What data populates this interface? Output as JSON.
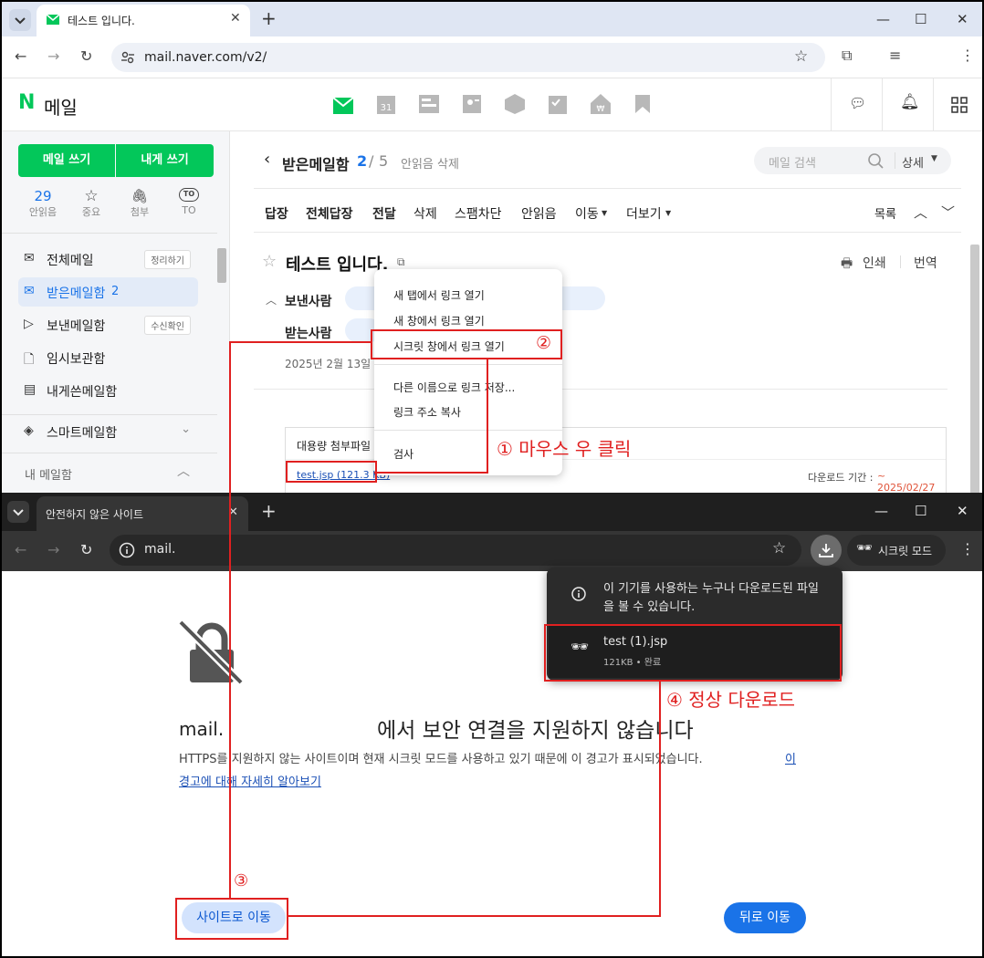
{
  "top_browser": {
    "tab_title": "테스트 입니다.",
    "url": "mail.naver.com/v2/"
  },
  "mail": {
    "logo_n": "N",
    "logo_text": "메일",
    "write_button": "메일 쓰기",
    "self_write_button": "내게 쓰기",
    "quick": [
      {
        "value": "29",
        "label": "안읽음"
      },
      {
        "label": "중요"
      },
      {
        "label": "첨부"
      },
      {
        "icon_text": "TO",
        "label": "TO"
      }
    ],
    "folders": [
      {
        "label": "전체메일",
        "chip": "정리하기"
      },
      {
        "label": "받은메일함",
        "count": "2"
      },
      {
        "label": "보낸메일함",
        "chip": "수신확인"
      },
      {
        "label": "임시보관함"
      },
      {
        "label": "내게쓴메일함"
      },
      {
        "label": "스마트메일함"
      }
    ],
    "my_folders_label": "내 메일함",
    "inbox_title": "받은메일함",
    "inbox_unread": "2",
    "inbox_total": "5",
    "delete_unread": "안읽음 삭제",
    "search_placeholder": "메일 검색",
    "detail_button": "상세",
    "toolbar": [
      "답장",
      "전체답장",
      "전달",
      "삭제",
      "스팸차단",
      "안읽음",
      "이동",
      "더보기"
    ],
    "list_button": "목록",
    "subject": "테스트 입니다.",
    "print": "인쇄",
    "translate": "번역",
    "sender_label": "보낸사람",
    "receiver_label": "받는사람",
    "date": "2025년 2월 13일",
    "attach_label": "대용량 첨부파일",
    "attach_link": "test.jsp (121.3 KB)",
    "download_period_label": "다운로드 기간 :",
    "download_period_value": "~ 2025/02/27"
  },
  "context_menu": {
    "items": [
      "새 탭에서 링크 열기",
      "새 창에서 링크 열기",
      "시크릿 창에서 링크 열기",
      "다른 이름으로 링크 저장...",
      "링크 주소 복사",
      "검사"
    ]
  },
  "bottom_browser": {
    "tab_title": "안전하지 않은 사이트",
    "url": "mail.",
    "incognito_label": "시크릿 모드",
    "download_warning": "이 기기를 사용하는 누구나 다운로드된 파일을 볼 수 있습니다.",
    "download_file": "test (1).jsp",
    "download_meta": "121KB • 완료",
    "site_name": "mail.",
    "headline": "에서 보안 연결을 지원하지 않습니다",
    "body_text": "HTTPS를 지원하지 않는 사이트이며 현재 시크릿 모드를 사용하고 있기 때문에 이 경고가 표시되었습니다.",
    "learn_more_1": "이",
    "learn_more_2": "경고에 대해 자세히 알아보기",
    "continue_button": "사이트로 이동",
    "back_button": "뒤로 이동"
  },
  "annotations": {
    "step1": "① 마우스 우 클릭",
    "step2": "②",
    "step3": "③",
    "step4": "④ 정상 다운로드"
  },
  "colors": {
    "naver_green": "#03c75a",
    "annotation_red": "#e02020",
    "link_blue": "#1a73e8"
  }
}
